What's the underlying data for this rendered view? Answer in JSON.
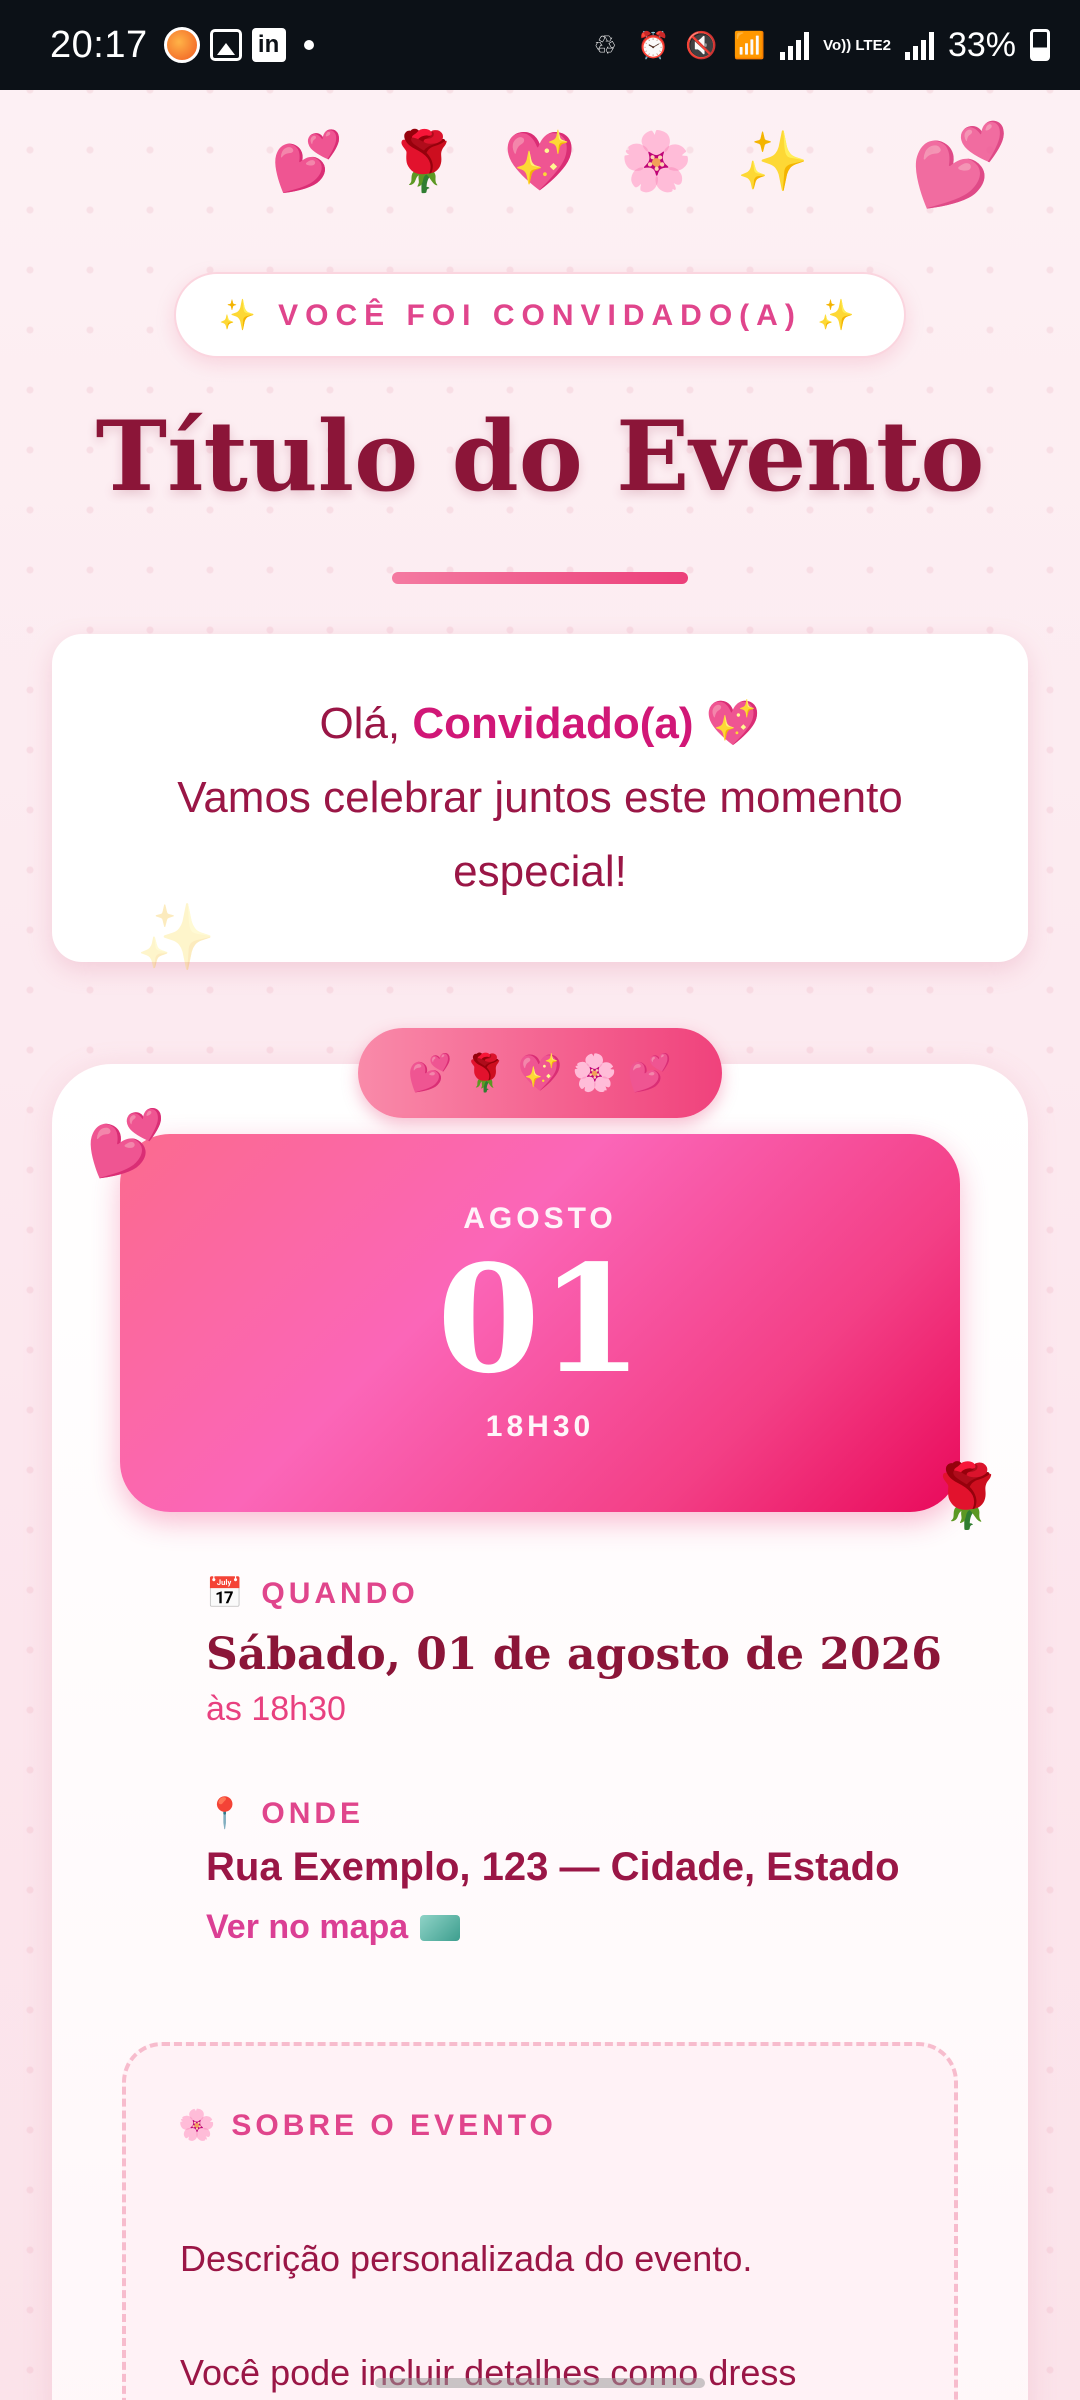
{
  "status_bar": {
    "time": "20:17",
    "network": "Vo)) LTE2",
    "battery": "33%"
  },
  "decor": {
    "top_emojis": [
      "💕",
      "🌹",
      "💖",
      "🌸",
      "✨"
    ],
    "corner_heart": "💕",
    "pill_emojis": [
      "💕",
      "🌹",
      "💖",
      "🌸",
      "💕"
    ],
    "left_heart": "💕",
    "right_rose": "🌹",
    "sparkles": "✨"
  },
  "invite": {
    "pill_text": "✨ VOCÊ FOI CONVIDADO(A) ✨",
    "event_title": "Título do Evento"
  },
  "greeting": {
    "hello": "Olá,",
    "guest_name": "Convidado(a)",
    "heart": "💖",
    "message": "Vamos celebrar juntos este momento especial!"
  },
  "date_card": {
    "month": "AGOSTO",
    "day": "01",
    "time": "18H30"
  },
  "when": {
    "icon": "📅",
    "label": "QUANDO",
    "date": "Sábado, 01 de agosto de 2026",
    "time": "às 18h30"
  },
  "where": {
    "icon": "📍",
    "label": "ONDE",
    "address": "Rua Exemplo, 123 — Cidade, Estado",
    "map_link": "Ver no mapa"
  },
  "about": {
    "icon": "🌸",
    "label": "SOBRE O EVENTO",
    "paragraphs": [
      "Descrição personalizada do evento.",
      "Você pode incluir detalhes como dress"
    ]
  },
  "colors": {
    "accent": "#e0458c",
    "title": "#8b1538",
    "date_gradient_start": "#fb6a8e",
    "date_gradient_end": "#e9095a"
  }
}
